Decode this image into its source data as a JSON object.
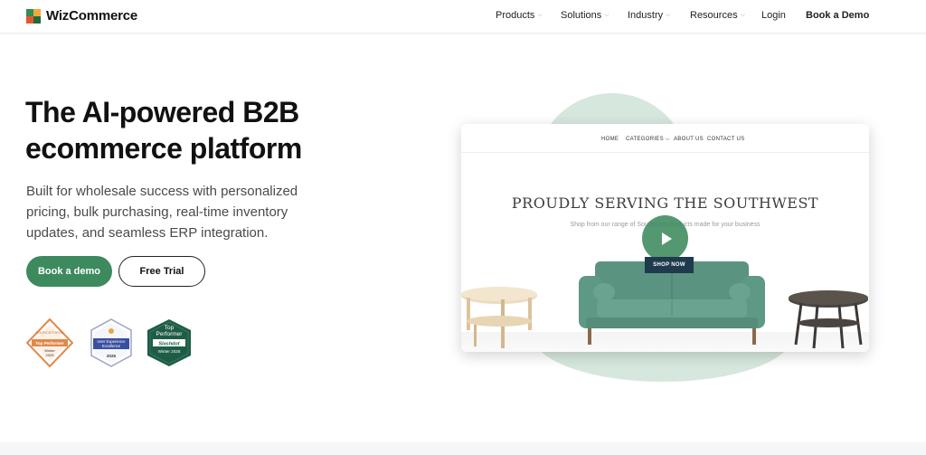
{
  "brand": {
    "name": "WizCommerce",
    "colors": {
      "primary": "#3c8a5e",
      "mint": "#d6e7dd",
      "dark": "#111111"
    }
  },
  "nav": {
    "items": [
      {
        "label": "Products",
        "has_dropdown": true
      },
      {
        "label": "Solutions",
        "has_dropdown": true
      },
      {
        "label": "Industry",
        "has_dropdown": true
      },
      {
        "label": "Resources",
        "has_dropdown": true
      },
      {
        "label": "Login",
        "has_dropdown": false
      }
    ],
    "cta_label": "Book a Demo",
    "chevron_glyph": "⌵"
  },
  "hero": {
    "title_line1": "The AI-powered B2B",
    "title_line2": "ecommerce platform",
    "subtitle": "Built for wholesale success with personalized pricing, bulk purchasing, real-time inventory updates, and seamless ERP integration.",
    "primary_button": "Book a demo",
    "secondary_button": "Free Trial"
  },
  "badges": [
    {
      "icon": "sourceforge-badge-icon",
      "top": "SOURCEFORGE",
      "label": "Top Performer",
      "line2": "Winter",
      "year": "2025"
    },
    {
      "icon": "ux-excellence-badge-icon",
      "label": "User Experience",
      "line2": "Excellence",
      "year": "2025"
    },
    {
      "icon": "slashdot-badge-icon",
      "label": "Top",
      "line2": "Performer",
      "brand": "Slashdot",
      "year": "Winter 2025"
    }
  ],
  "mockup": {
    "nav": [
      "HOME",
      "CATEGORIES ⌵",
      "ABOUT US",
      "CONTACT US"
    ],
    "heading": "PROUDLY SERVING THE SOUTHWEST",
    "subtext": "Shop from our range of Southwest products made for your business",
    "shop_now": "SHOP NOW",
    "play_icon": "play-icon"
  }
}
